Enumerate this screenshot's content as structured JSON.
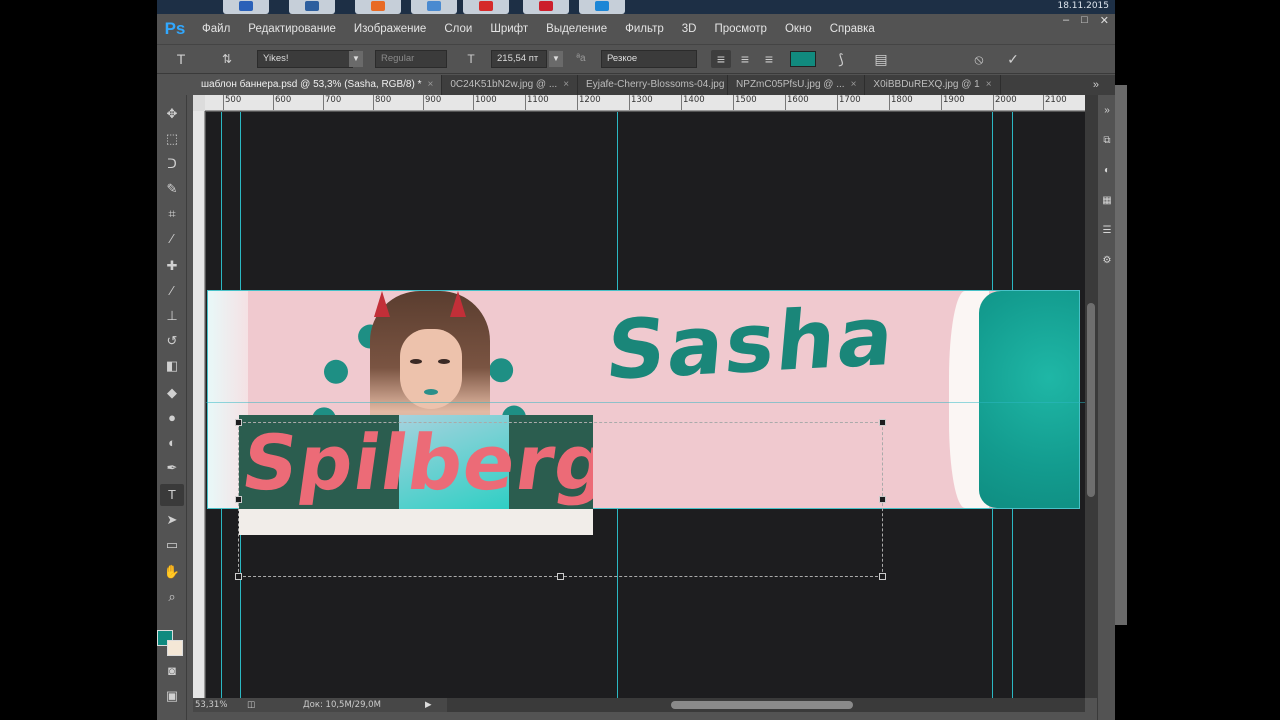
{
  "taskbar": {
    "buttons": [
      {
        "name": "taskbar-app-1",
        "color": "#2a60b8"
      },
      {
        "name": "taskbar-app-2",
        "color": "#2e5f9e"
      },
      {
        "name": "taskbar-app-3",
        "color": "#e86a24"
      },
      {
        "name": "taskbar-app-4",
        "color": "#4a8ad0"
      },
      {
        "name": "taskbar-app-5",
        "color": "#d52a2a"
      },
      {
        "name": "taskbar-app-6",
        "color": "#cc1f2c"
      },
      {
        "name": "taskbar-app-7",
        "color": "#1c86d6"
      }
    ],
    "clock": "18.11.2015"
  },
  "app": {
    "logo": "Ps"
  },
  "menu": [
    "Файл",
    "Редактирование",
    "Изображение",
    "Слои",
    "Шрифт",
    "Выделение",
    "Фильтр",
    "3D",
    "Просмотр",
    "Окно",
    "Справка"
  ],
  "window_controls": {
    "minimize": "–",
    "maximize": "□",
    "close": "✕"
  },
  "options": {
    "tool_icon": "T",
    "font_family": "Yikes!",
    "font_style": "Regular",
    "font_size": "215,54 пт",
    "aa_label": "ªa",
    "aa_mode": "Резкое",
    "text_color": "#118a7e",
    "cancel_icon": "⦸",
    "commit_icon": "✓"
  },
  "tabs": [
    {
      "label": "шаблон баннера.psd @ 53,3% (Sasha, RGB/8) *",
      "active": true
    },
    {
      "label": "0C24K51bN2w.jpg @ ...",
      "active": false
    },
    {
      "label": "Eyjafe-Cherry-Blossoms-04.jpg",
      "active": false
    },
    {
      "label": "NPZmC05PfsU.jpg @ ...",
      "active": false
    },
    {
      "label": "X0iBBDuREXQ.jpg @ 1",
      "active": false
    }
  ],
  "tabs_more": "»",
  "ruler_top": [
    "500",
    "600",
    "700",
    "800",
    "900",
    "1000",
    "1100",
    "1200",
    "1300",
    "1400",
    "1500",
    "1600",
    "1700",
    "1800",
    "1900",
    "2000",
    "2100"
  ],
  "canvas": {
    "title_text": "Sasha",
    "subtitle_text": "Spilberg"
  },
  "status": {
    "zoom": "53,31%",
    "doc": "Док: 10,5M/29,0M",
    "arrow": "▶"
  },
  "colors": {
    "foreground": "#0f8a7f",
    "background": "#f4e7d6",
    "guide": "#2bb8c3"
  }
}
